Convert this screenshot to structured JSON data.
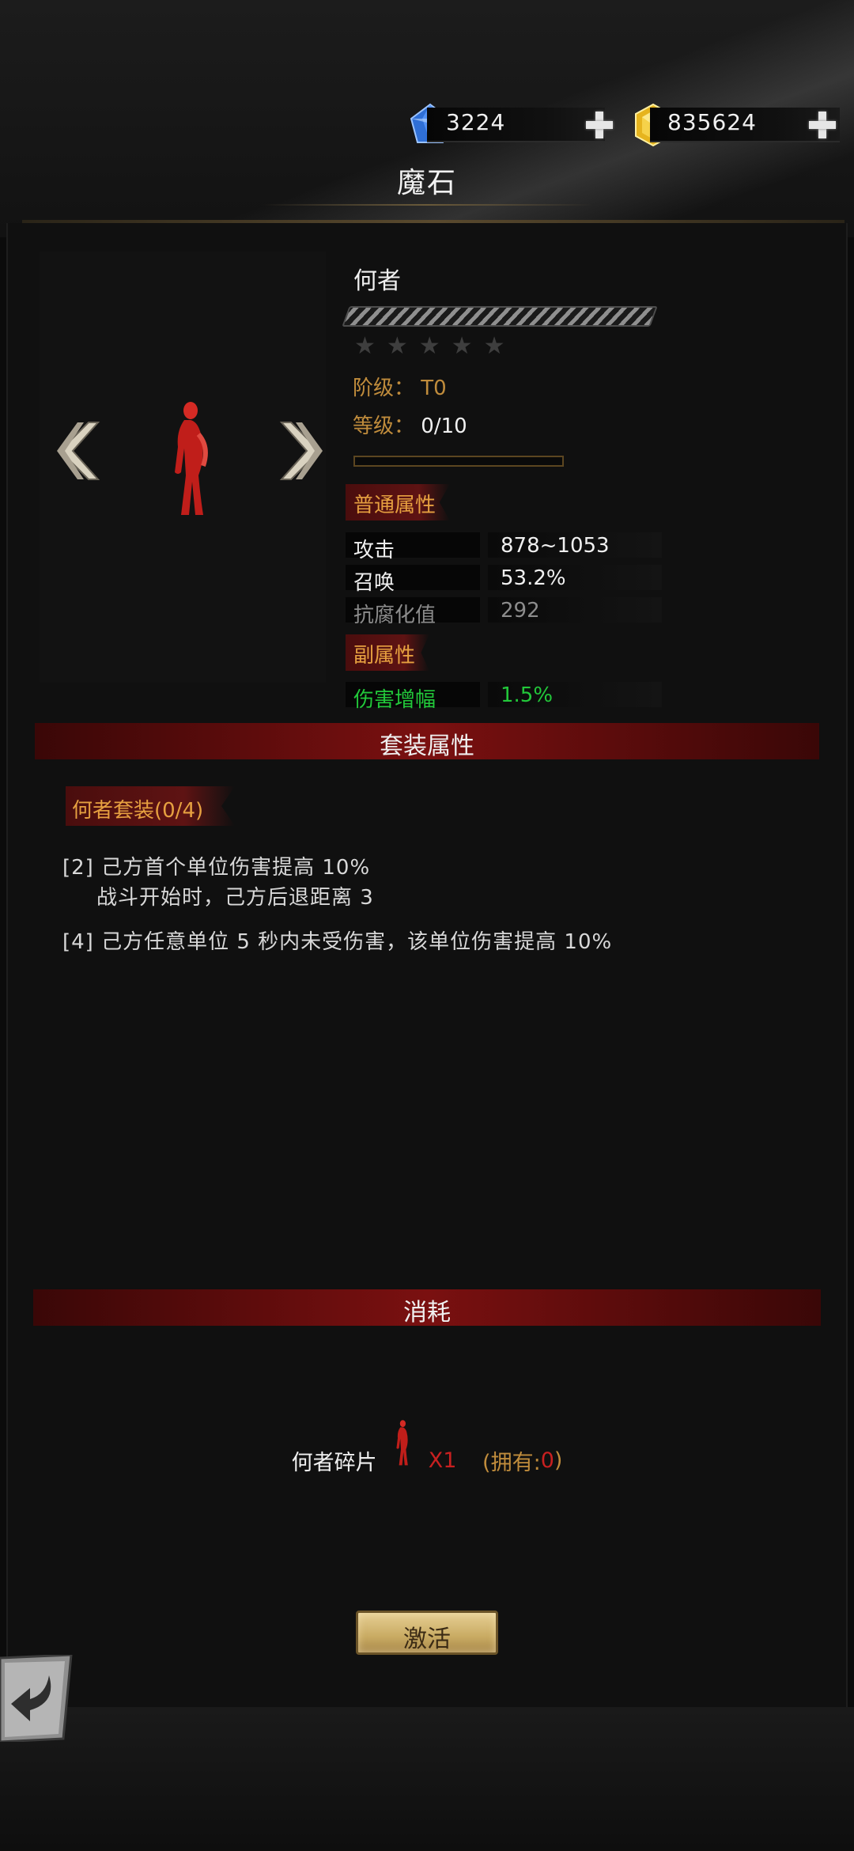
{
  "currency": {
    "gems": "3224",
    "gold": "835624"
  },
  "page": {
    "title": "魔石"
  },
  "item": {
    "name": "何者",
    "stars": "★★★★★",
    "grade_label": "阶级：",
    "grade_value": "T0",
    "level_label": "等级：",
    "level_value": "0/10"
  },
  "sections": {
    "normal_attr": "普通属性",
    "sub_attr": "副属性",
    "set_attr": "套装属性",
    "cost": "消耗"
  },
  "normal_attributes": [
    {
      "key": "攻击",
      "value": "878~1053"
    },
    {
      "key": "召唤",
      "value": "53.2%"
    },
    {
      "key": "抗腐化值",
      "value": "292"
    }
  ],
  "sub_attributes": [
    {
      "key": "伤害增幅",
      "value": "1.5%"
    }
  ],
  "set": {
    "label": "何者套装(0/4)",
    "bonus_2_line1": "[2] 己方首个单位伤害提高 10%",
    "bonus_2_line2": "战斗开始时，己方后退距离 3",
    "bonus_4": "[4] 己方任意单位 5 秒内未受伤害，该单位伤害提高 10%"
  },
  "cost": {
    "item_name": "何者碎片",
    "qty": "X1",
    "own_prefix": "(拥有: ",
    "own_value": "0",
    "own_suffix": ")"
  },
  "actions": {
    "activate": "激活"
  },
  "colors": {
    "accent_red": "#7a1010",
    "label_orange": "#e6a040",
    "gold_text": "#c08c3c",
    "sub_attr_green": "#22c83a"
  }
}
